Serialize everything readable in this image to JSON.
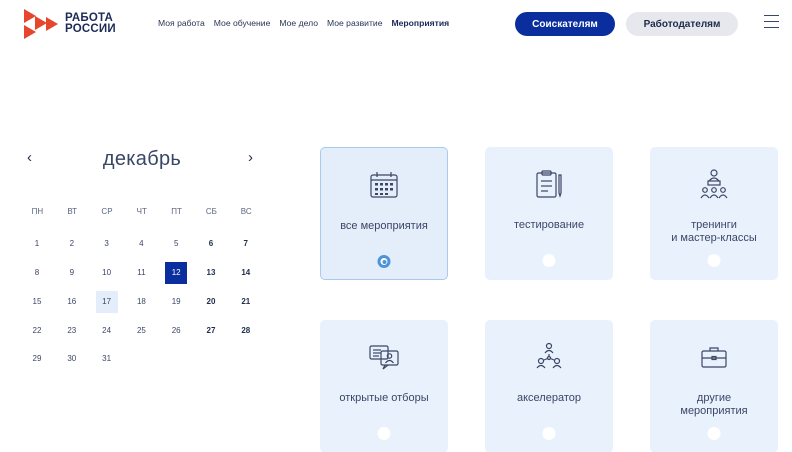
{
  "logo": {
    "line1": "РАБОТА",
    "line2": "РОССИИ"
  },
  "nav": [
    {
      "label": "Моя работа",
      "active": false
    },
    {
      "label": "Мое обучение",
      "active": false
    },
    {
      "label": "Мое дело",
      "active": false
    },
    {
      "label": "Мое развитие",
      "active": false
    },
    {
      "label": "Мероприятия",
      "active": true
    }
  ],
  "buttons": {
    "seekers": "Соискателям",
    "employers": "Работодателям"
  },
  "colors": {
    "primary": "#0b2e9e",
    "tile_bg": "#e9f2fc",
    "accent": "#4d94d6",
    "logo_red": "#e6462b"
  },
  "calendar": {
    "prev": "‹",
    "next": "›",
    "month": "декабрь",
    "weekdays": [
      "ПН",
      "ВТ",
      "СР",
      "ЧТ",
      "ПТ",
      "СБ",
      "ВС"
    ],
    "leading_blanks": 0,
    "days": [
      "1",
      "2",
      "3",
      "4",
      "5",
      "6",
      "7",
      "8",
      "9",
      "10",
      "11",
      "12",
      "13",
      "14",
      "15",
      "16",
      "17",
      "18",
      "19",
      "20",
      "21",
      "22",
      "23",
      "24",
      "25",
      "26",
      "27",
      "28",
      "29",
      "30",
      "31"
    ],
    "selected": "12",
    "today": "17"
  },
  "events": [
    {
      "label": "все мероприятия",
      "icon": "calendar-icon",
      "active": true
    },
    {
      "label": "тестирование",
      "icon": "clipboard-pencil-icon",
      "active": false
    },
    {
      "label": "тренинги\nи мастер-классы",
      "icon": "training-group-icon",
      "active": false
    },
    {
      "label": "открытые отборы",
      "icon": "chat-profile-icon",
      "active": false
    },
    {
      "label": "акселератор",
      "icon": "team-network-icon",
      "active": false
    },
    {
      "label": "другие\nмероприятия",
      "icon": "briefcase-icon",
      "active": false
    }
  ]
}
